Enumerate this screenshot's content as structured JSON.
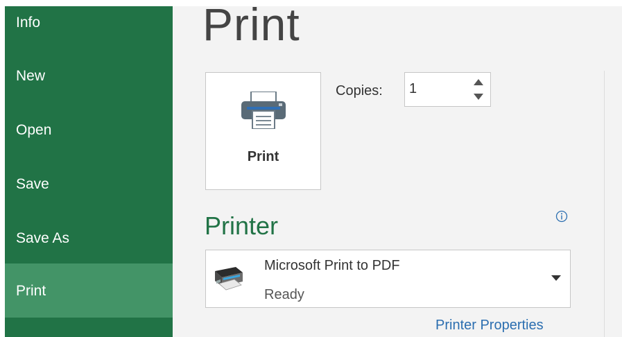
{
  "sidebar": {
    "items": [
      {
        "label": "Info"
      },
      {
        "label": "New"
      },
      {
        "label": "Open"
      },
      {
        "label": "Save"
      },
      {
        "label": "Save As"
      },
      {
        "label": "Print",
        "selected": true
      }
    ]
  },
  "main": {
    "title": "Print",
    "print_button_label": "Print",
    "copies": {
      "label": "Copies:",
      "value": "1"
    },
    "printer_section": {
      "heading": "Printer",
      "selected_printer": "Microsoft Print to PDF",
      "status": "Ready",
      "properties_link": "Printer Properties"
    }
  },
  "icons": {
    "print": "printer-icon",
    "info": "info-icon",
    "pdf_printer": "pdf-printer-icon",
    "dropdown": "chevron-down-icon",
    "spin_up": "spin-up-icon",
    "spin_down": "spin-down-icon"
  },
  "colors": {
    "sidebar": "#217346",
    "sidebar_selected": "#439467",
    "accent_heading": "#217346",
    "link": "#2b6eb0",
    "main_bg": "#f3f3f3"
  }
}
